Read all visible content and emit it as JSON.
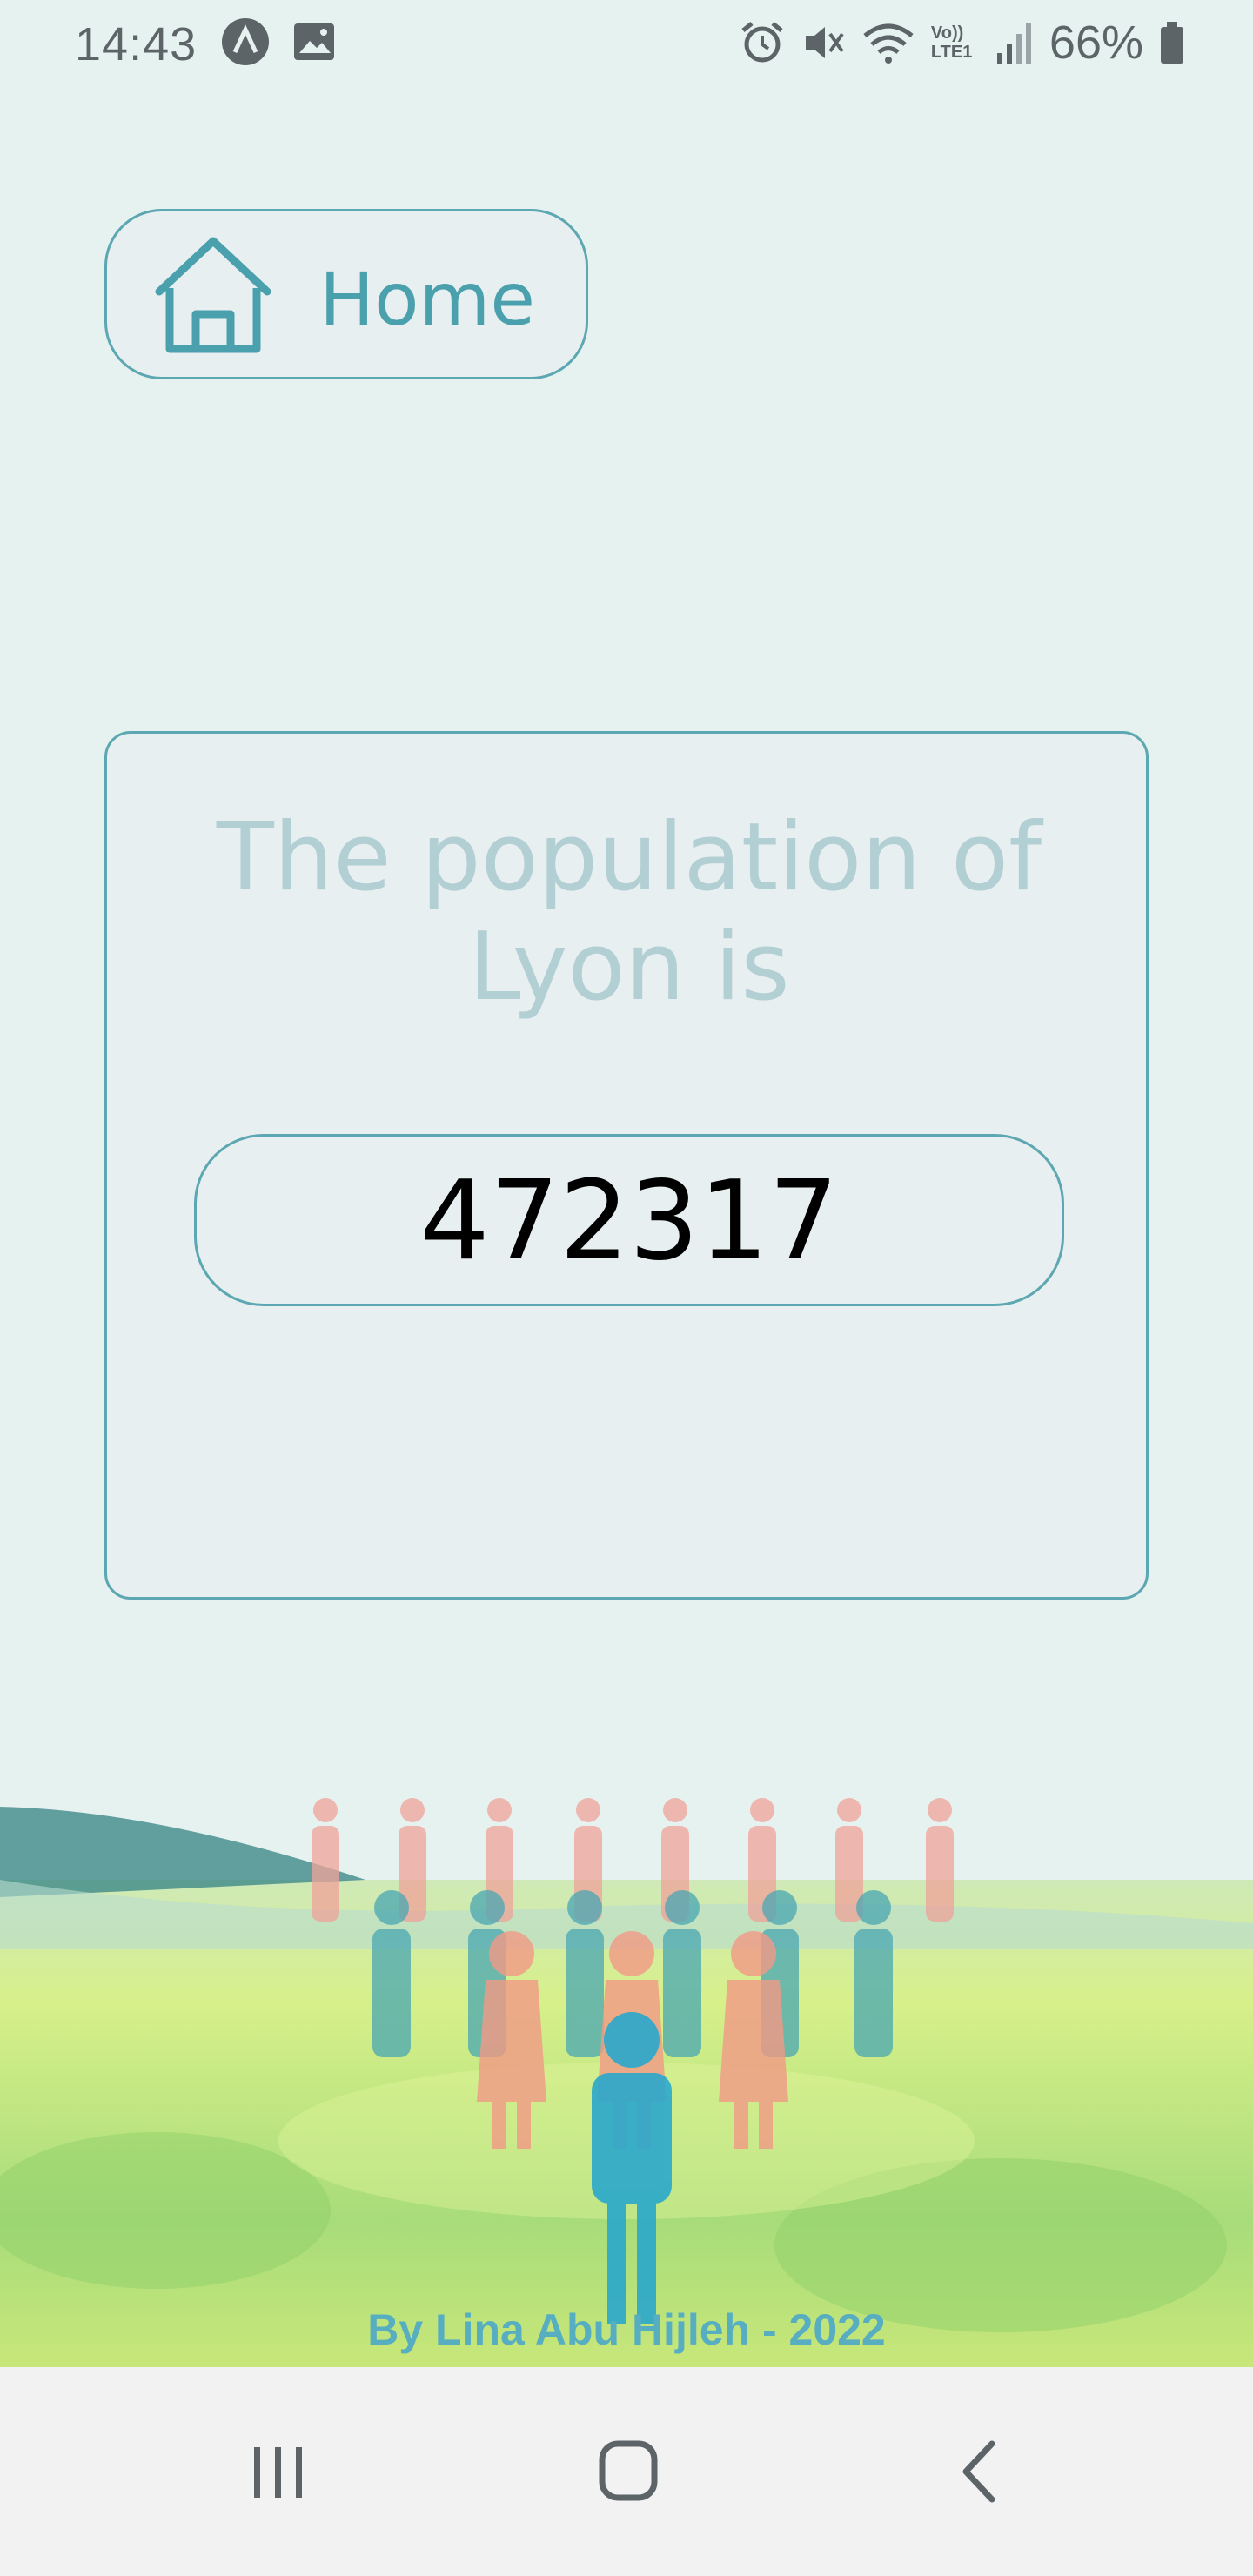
{
  "status_bar": {
    "time": "14:43",
    "battery_percent": "66%",
    "icons_left": [
      "app-notification-icon",
      "image-icon"
    ],
    "icons_right": [
      "alarm-icon",
      "mute-icon",
      "wifi-icon",
      "volte-icon",
      "signal-icon",
      "battery-icon"
    ],
    "volte_text": "Vo)) LTE1"
  },
  "home_button": {
    "label": "Home",
    "icon": "house-icon"
  },
  "card": {
    "title": "The population of\nLyon is",
    "value": "472317"
  },
  "footer": {
    "credit": "By Lina Abu Hijleh - 2022"
  },
  "nav_bar": {
    "items": [
      "recent-apps-icon",
      "home-circle-icon",
      "back-chevron-icon"
    ]
  },
  "colors": {
    "background": "#e6f2ef",
    "accent": "#5ca7b1",
    "title_text": "#b2cfd3",
    "credit_text": "#58aec1"
  }
}
